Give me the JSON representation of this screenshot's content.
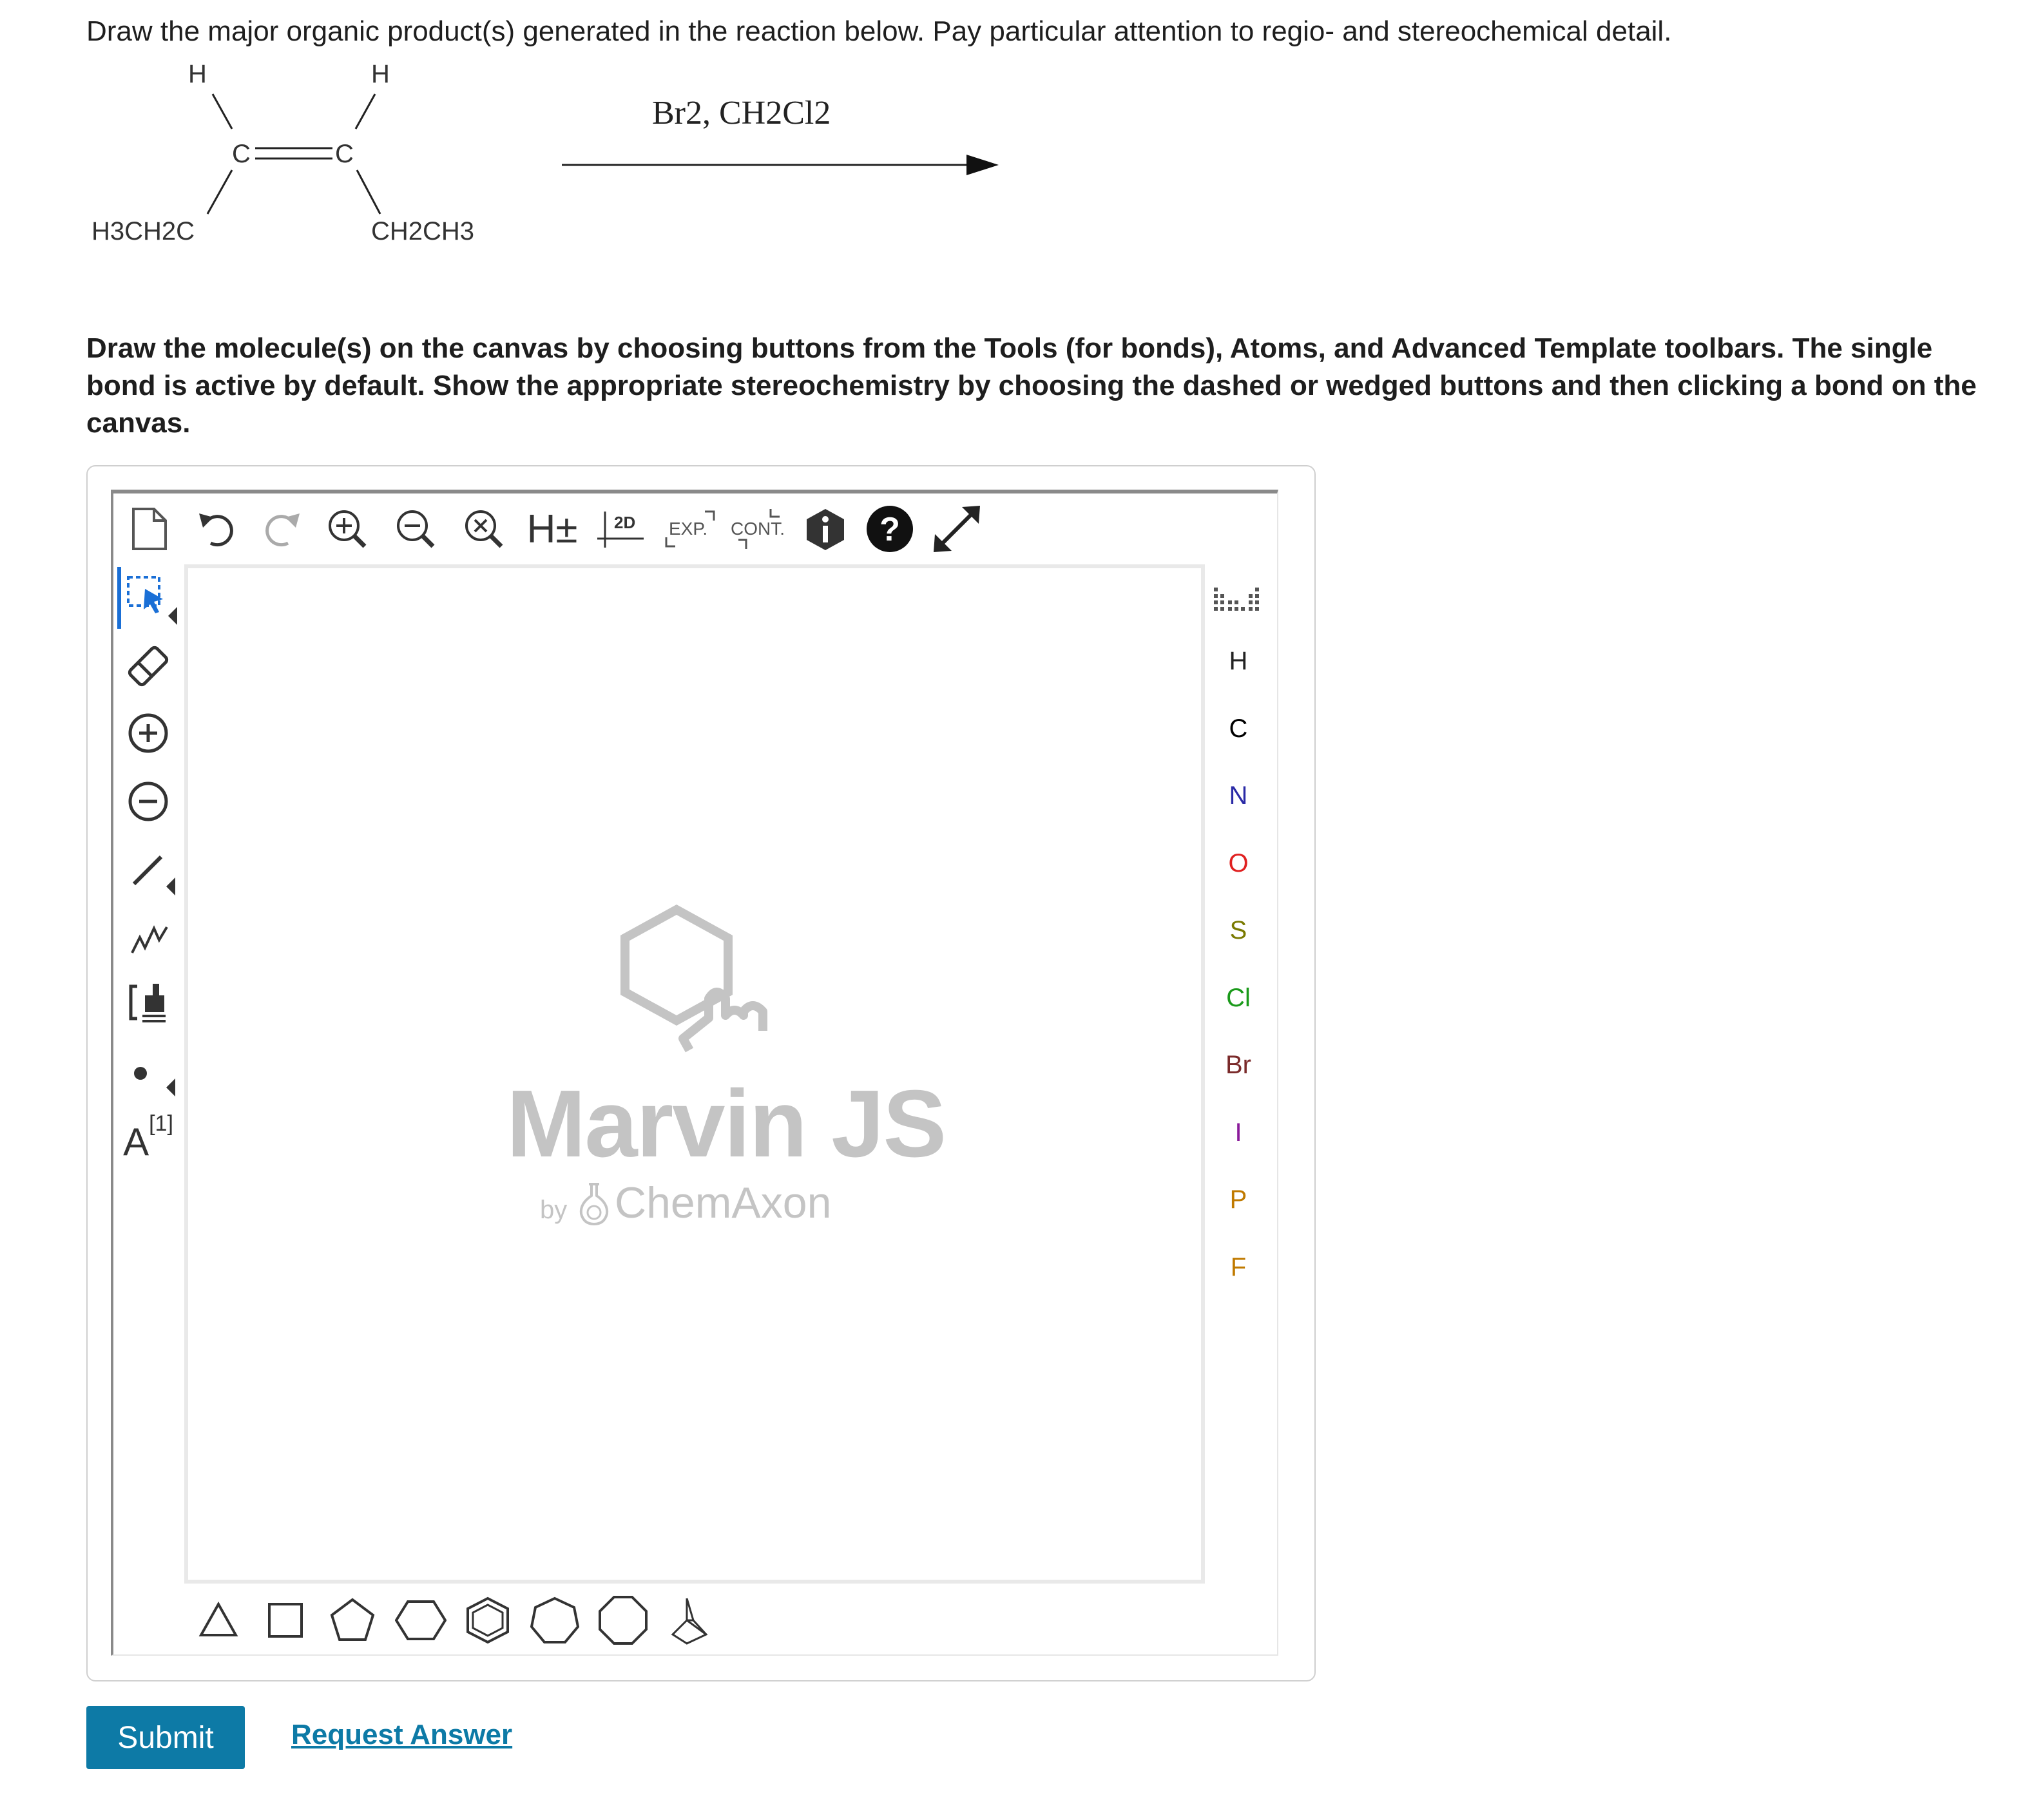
{
  "question": "Draw the major organic product(s) generated in the reaction below. Pay particular attention to regio- and stereochemical detail.",
  "reaction": {
    "atom_h_left": "H",
    "atom_h_right": "H",
    "atom_c_left": "C",
    "atom_c_right": "C",
    "substituent_left": "H3CH2C",
    "substituent_right": "CH2CH3",
    "reagents": "Br2, CH2Cl2"
  },
  "instructions": "Draw the molecule(s) on the canvas by choosing buttons from the Tools (for bonds), Atoms, and Advanced Template toolbars. The single bond is active by default. Show the appropriate stereochemistry by choosing the dashed or wedged buttons and then clicking a bond on the canvas.",
  "toolbar": {
    "h_toggle": "H±",
    "clean2d": "2D",
    "expand": "EXP.",
    "contract": "CONT."
  },
  "left_tools": {
    "atom_label": "A",
    "atom_label_index": "[1]"
  },
  "atoms": [
    {
      "symbol": "H",
      "color": "#222222"
    },
    {
      "symbol": "C",
      "color": "#000000"
    },
    {
      "symbol": "N",
      "color": "#2a2aa6"
    },
    {
      "symbol": "O",
      "color": "#e02020"
    },
    {
      "symbol": "S",
      "color": "#7a7a00"
    },
    {
      "symbol": "Cl",
      "color": "#1a9a1a"
    },
    {
      "symbol": "Br",
      "color": "#7a2a2a"
    },
    {
      "symbol": "I",
      "color": "#8a1a9a"
    },
    {
      "symbol": "P",
      "color": "#c07a00"
    },
    {
      "symbol": "F",
      "color": "#c07a00"
    }
  ],
  "logo": {
    "title": "Marvin JS",
    "by": "by",
    "company": "ChemAxon"
  },
  "actions": {
    "submit": "Submit",
    "request_answer": "Request Answer"
  },
  "colors": {
    "accent": "#0d7aa6",
    "select_highlight": "#1a6fd6"
  }
}
